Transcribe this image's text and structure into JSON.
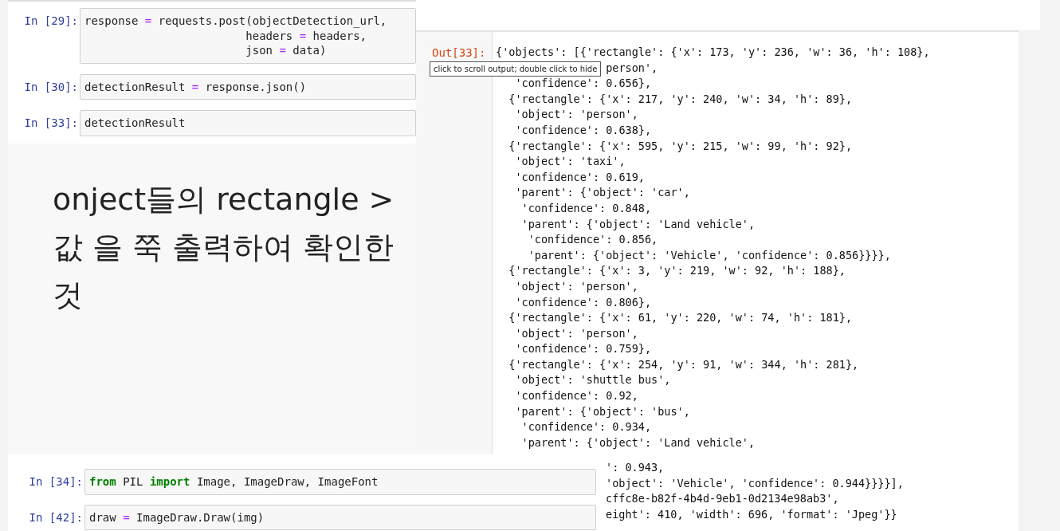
{
  "notebook_top": {
    "cells": [
      {
        "prompt": "In [29]:",
        "lines": [
          [
            {
              "t": "response ",
              "kind": "plain"
            },
            {
              "t": "=",
              "kind": "op"
            },
            {
              "t": " requests.post(objectDetection_url,",
              "kind": "plain"
            }
          ],
          [
            {
              "t": "                        headers ",
              "kind": "plain"
            },
            {
              "t": "=",
              "kind": "op"
            },
            {
              "t": " headers,",
              "kind": "plain"
            }
          ],
          [
            {
              "t": "                        json ",
              "kind": "plain"
            },
            {
              "t": "=",
              "kind": "op"
            },
            {
              "t": " data)",
              "kind": "plain"
            }
          ]
        ]
      },
      {
        "prompt": "In [30]:",
        "lines": [
          [
            {
              "t": "detectionResult ",
              "kind": "plain"
            },
            {
              "t": "=",
              "kind": "op"
            },
            {
              "t": " response.json()",
              "kind": "plain"
            }
          ]
        ]
      },
      {
        "prompt": "In [33]:",
        "lines": [
          [
            {
              "t": "detectionResult",
              "kind": "plain"
            }
          ]
        ]
      }
    ]
  },
  "output_panel": {
    "prompt": "Out[33]:",
    "tooltip": "click to scroll output; double click to hide",
    "lines": [
      "{'objects': [{'rectangle': {'x': 173, 'y': 236, 'w': 36, 'h': 108},",
      "                 person',",
      "   'confidence': 0.656},",
      "  {'rectangle': {'x': 217, 'y': 240, 'w': 34, 'h': 89},",
      "   'object': 'person',",
      "   'confidence': 0.638},",
      "  {'rectangle': {'x': 595, 'y': 215, 'w': 99, 'h': 92},",
      "   'object': 'taxi',",
      "   'confidence': 0.619,",
      "   'parent': {'object': 'car',",
      "    'confidence': 0.848,",
      "    'parent': {'object': 'Land vehicle',",
      "     'confidence': 0.856,",
      "     'parent': {'object': 'Vehicle', 'confidence': 0.856}}}},",
      "  {'rectangle': {'x': 3, 'y': 219, 'w': 92, 'h': 188},",
      "   'object': 'person',",
      "   'confidence': 0.806},",
      "  {'rectangle': {'x': 61, 'y': 220, 'w': 74, 'h': 181},",
      "   'object': 'person',",
      "   'confidence': 0.759},",
      "  {'rectangle': {'x': 254, 'y': 91, 'w': 344, 'h': 281},",
      "   'object': 'shuttle bus',",
      "   'confidence': 0.92,",
      "   'parent': {'object': 'bus',",
      "    'confidence': 0.934,",
      "    'parent': {'object': 'Land vehicle',"
    ],
    "overflow_lines": [
      "': 0.943,",
      "'object': 'Vehicle', 'confidence': 0.944}}}}],",
      "cffc8e-b82f-4b4d-9eb1-0d2134e98ab3',",
      "eight': 410, 'width': 696, 'format': 'Jpeg'}}"
    ]
  },
  "note": {
    "text": "onject들의 rectangle >\n값 을 쭉 출력하여 확인한\n것"
  },
  "notebook_bottom": {
    "cells": [
      {
        "prompt": "In [34]:",
        "lines": [
          [
            {
              "t": "from",
              "kind": "kw"
            },
            {
              "t": " PIL ",
              "kind": "plain"
            },
            {
              "t": "import",
              "kind": "kw"
            },
            {
              "t": " Image, ImageDraw, ImageFont",
              "kind": "plain"
            }
          ]
        ]
      },
      {
        "prompt": "In [42]:",
        "lines": [
          [
            {
              "t": "draw ",
              "kind": "plain"
            },
            {
              "t": "=",
              "kind": "op"
            },
            {
              "t": " ImageDraw.Draw(img)",
              "kind": "plain"
            }
          ]
        ]
      }
    ]
  }
}
